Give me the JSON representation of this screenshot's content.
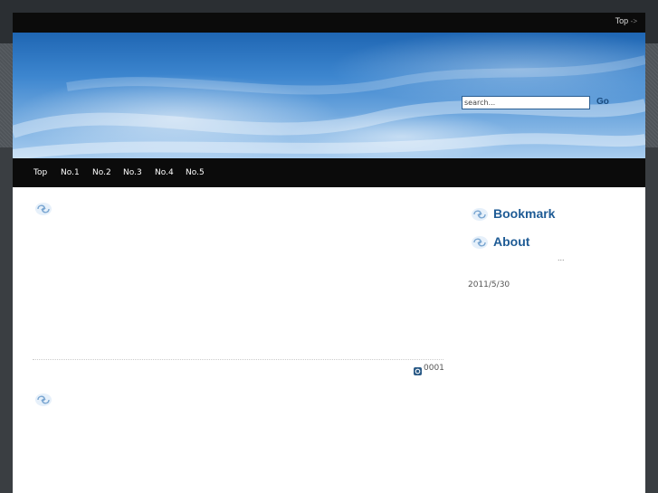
{
  "header": {
    "top_link_label": "Top",
    "top_link_arrow": "->"
  },
  "search": {
    "placeholder": "search...",
    "go_label": "Go"
  },
  "nav": {
    "items": [
      {
        "label": "Top"
      },
      {
        "label": "No.1"
      },
      {
        "label": "No.2"
      },
      {
        "label": "No.3"
      },
      {
        "label": "No.4"
      },
      {
        "label": "No.5"
      }
    ]
  },
  "sidebar": {
    "bookmark_heading": "Bookmark",
    "about_heading": "About",
    "about_ellipsis": "...",
    "date": "2011/5/30"
  },
  "main": {
    "entry_count": "0001"
  },
  "icons": {
    "swirl": "swirl-icon",
    "badge": "count-icon"
  },
  "colors": {
    "heading": "#1e5b95",
    "navbar": "#0b0b0b",
    "banner_sky": "#3d86cf"
  }
}
